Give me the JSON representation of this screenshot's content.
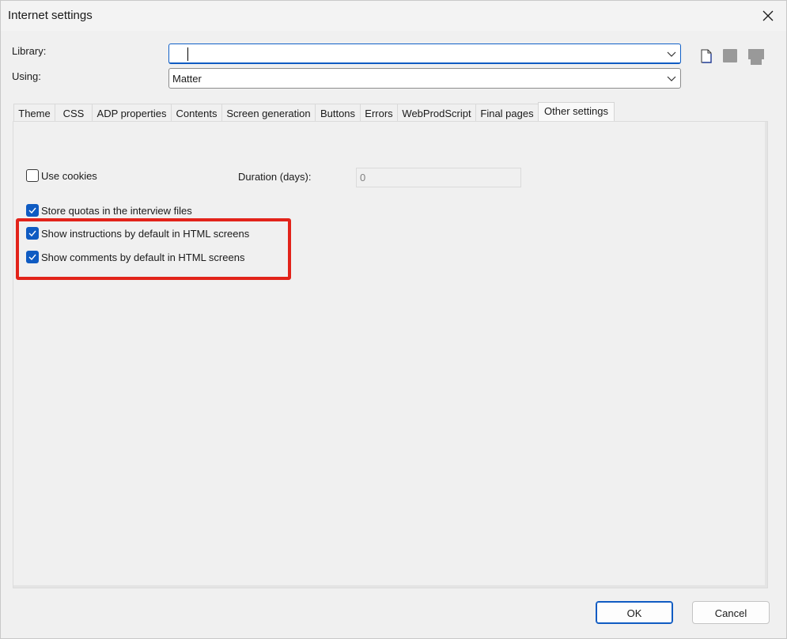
{
  "window": {
    "title": "Internet settings"
  },
  "form": {
    "library_label": "Library:",
    "library_value": "",
    "using_label": "Using:",
    "using_value": "Matter"
  },
  "tabs": [
    {
      "label": "Theme"
    },
    {
      "label": "CSS"
    },
    {
      "label": "ADP properties"
    },
    {
      "label": "Contents"
    },
    {
      "label": "Screen generation"
    },
    {
      "label": "Buttons"
    },
    {
      "label": "Errors"
    },
    {
      "label": "WebProdScript"
    },
    {
      "label": "Final pages"
    },
    {
      "label": "Other settings"
    }
  ],
  "active_tab": "Other settings",
  "other_settings": {
    "use_cookies": {
      "label": "Use cookies",
      "checked": false
    },
    "duration_label": "Duration (days):",
    "duration_value": "0",
    "store_quotas": {
      "label": "Store quotas in the interview files",
      "checked": true
    },
    "show_instructions": {
      "label": "Show instructions by default in HTML screens",
      "checked": true
    },
    "show_comments": {
      "label": "Show comments by default in HTML screens",
      "checked": true
    }
  },
  "buttons": {
    "ok": "OK",
    "cancel": "Cancel"
  },
  "colors": {
    "accent": "#0f5bc2",
    "highlight": "#e2231a"
  },
  "icons": [
    "close-icon",
    "chevron-down-icon",
    "new-file-icon",
    "save-icon",
    "delete-icon",
    "checkmark-icon"
  ]
}
